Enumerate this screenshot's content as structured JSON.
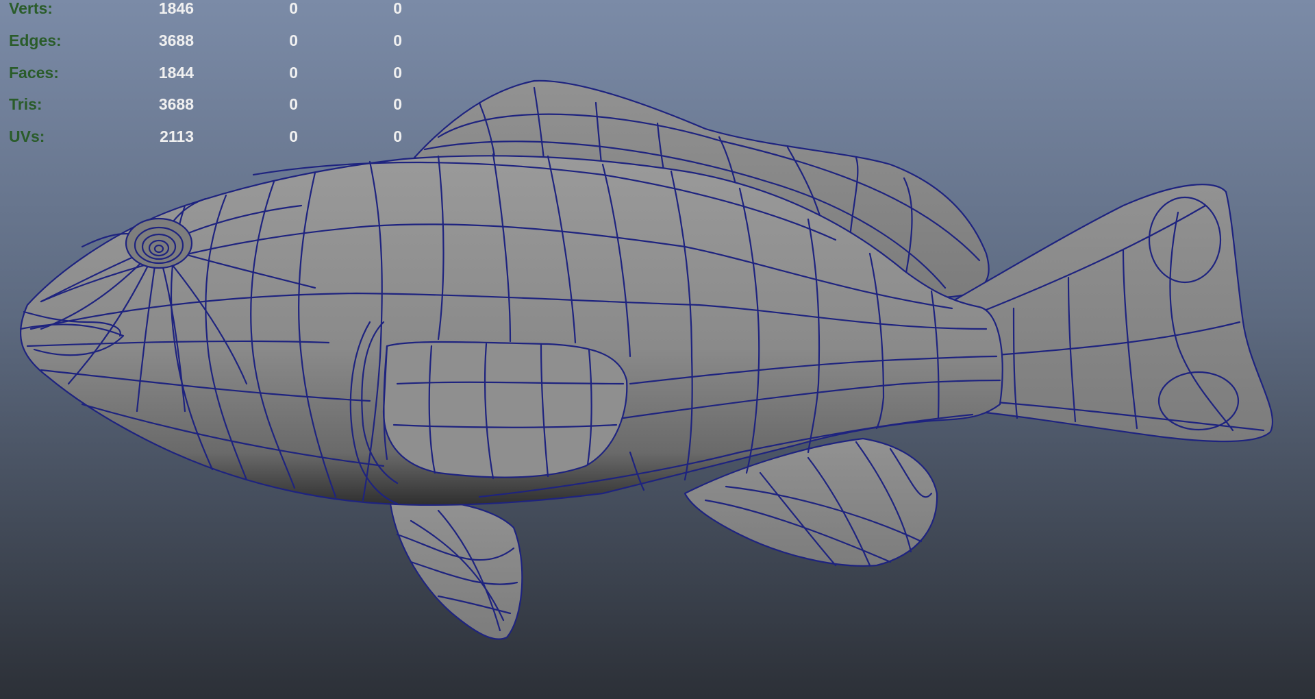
{
  "app": "3D viewport - polygon mesh",
  "colors": {
    "bg_top": "#7a8aa6",
    "bg_mid": "#5b6679",
    "bg_bottom": "#2e3239",
    "hud_label": "#2a5c2a",
    "hud_value": "#f0f0f0",
    "wireframe": "#1e237f",
    "mesh_fill": "#8c8c8c",
    "mesh_shadow": "#3e3e3e"
  },
  "hud": {
    "rows": [
      {
        "label": "Verts:",
        "total": "1846",
        "selected": "0",
        "triangles": "0"
      },
      {
        "label": "Edges:",
        "total": "3688",
        "selected": "0",
        "triangles": "0"
      },
      {
        "label": "Faces:",
        "total": "1844",
        "selected": "0",
        "triangles": "0"
      },
      {
        "label": "Tris:",
        "total": "3688",
        "selected": "0",
        "triangles": "0"
      },
      {
        "label": "UVs:",
        "total": "2113",
        "selected": "0",
        "triangles": "0"
      }
    ]
  },
  "object": {
    "icon": "fish-mesh",
    "display_mode": "wireframe-on-shaded"
  }
}
